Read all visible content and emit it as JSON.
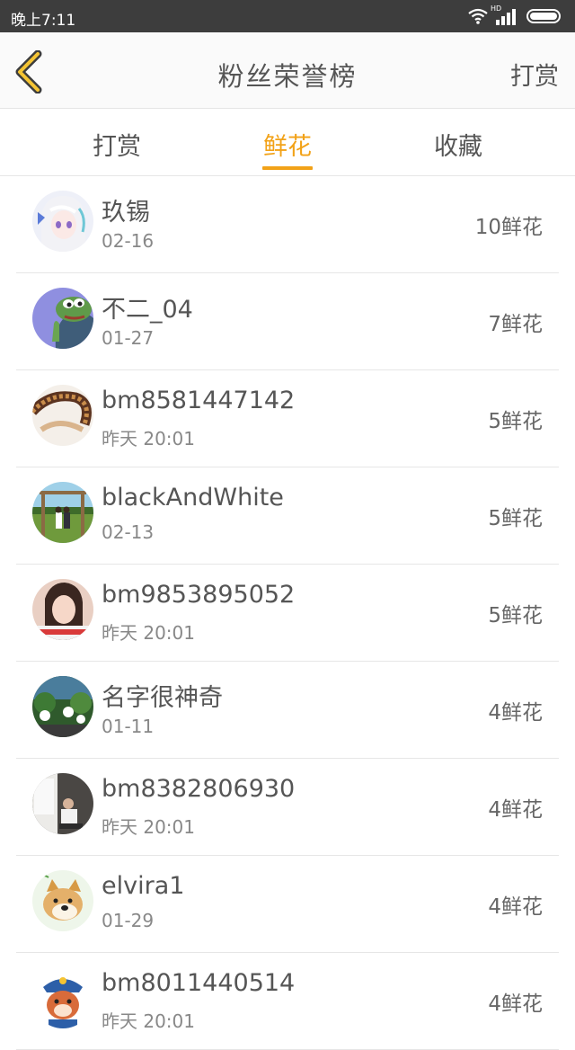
{
  "status_bar": {
    "time": "晚上7:11",
    "network": "HD",
    "icons": [
      "wifi-icon",
      "signal-icon",
      "battery-icon"
    ]
  },
  "header": {
    "back_icon": "chevron-left-icon",
    "title": "粉丝荣誉榜",
    "action": "打赏"
  },
  "tabs": [
    {
      "label": "打赏",
      "active": false
    },
    {
      "label": "鲜花",
      "active": true
    },
    {
      "label": "收藏",
      "active": false
    }
  ],
  "colors": {
    "accent": "#f2a218",
    "text": "#555555",
    "status_bar": "#3d3d3d"
  },
  "fans": [
    {
      "name": "玖锡",
      "date": "02-16",
      "count": "10鲜花",
      "avatar": "anime-girl-avatar"
    },
    {
      "name": "不二_04",
      "date": "01-27",
      "count": "7鲜花",
      "avatar": "pepe-frog-avatar"
    },
    {
      "name": "bm8581447142",
      "date": "昨天 20:01",
      "count": "5鲜花",
      "avatar": "film-reel-avatar"
    },
    {
      "name": "blackAndWhite",
      "date": "02-13",
      "count": "5鲜花",
      "avatar": "couple-swing-avatar"
    },
    {
      "name": "bm9853895052",
      "date": "昨天 20:01",
      "count": "5鲜花",
      "avatar": "girl-photo-avatar"
    },
    {
      "name": "名字很神奇",
      "date": "01-11",
      "count": "4鲜花",
      "avatar": "green-scene-avatar"
    },
    {
      "name": "bm8382806930",
      "date": "昨天 20:01",
      "count": "4鲜花",
      "avatar": "person-window-avatar"
    },
    {
      "name": "elvira1",
      "date": "01-29",
      "count": "4鲜花",
      "avatar": "doge-avatar"
    },
    {
      "name": "bm8011440514",
      "date": "昨天 20:01",
      "count": "4鲜花",
      "avatar": "cartoon-police-avatar"
    }
  ]
}
